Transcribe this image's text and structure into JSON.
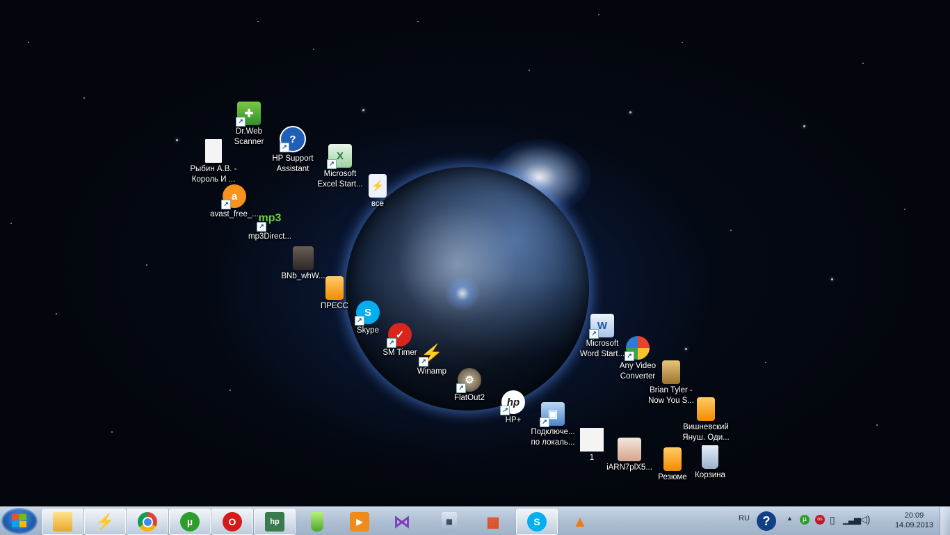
{
  "desktop": {
    "icons": [
      {
        "label": "Dr.Web\nScanner",
        "icon": "drweb-icon"
      },
      {
        "label": "HP Support\nAssistant",
        "icon": "help-icon"
      },
      {
        "label": "Рыбин А.В. -\nКороль И ...",
        "icon": "document-icon"
      },
      {
        "label": "Microsoft\nExcel Start...",
        "icon": "excel-icon"
      },
      {
        "label": "все",
        "icon": "winamp-playlist-icon"
      },
      {
        "label": "avast_free_...",
        "icon": "avast-icon"
      },
      {
        "label": "mp3Direct...",
        "icon": "mp3-icon"
      },
      {
        "label": "BNb_whW...",
        "icon": "image-icon"
      },
      {
        "label": "ПРЕСС",
        "icon": "folder-icon"
      },
      {
        "label": "Skype",
        "icon": "skype-icon"
      },
      {
        "label": "SM Timer",
        "icon": "timer-icon"
      },
      {
        "label": "Winamp",
        "icon": "winamp-icon"
      },
      {
        "label": "FlatOut2",
        "icon": "flatout-icon"
      },
      {
        "label": "HP+",
        "icon": "hp-icon"
      },
      {
        "label": "Подключе...\nпо локаль...",
        "icon": "network-icon"
      },
      {
        "label": "1",
        "icon": "image-icon"
      },
      {
        "label": "iARN7plX5...",
        "icon": "image-icon"
      },
      {
        "label": "Резюме",
        "icon": "folder-icon"
      },
      {
        "label": "Корзина",
        "icon": "recycle-bin-icon"
      },
      {
        "label": "Microsoft\nWord Start...",
        "icon": "word-icon"
      },
      {
        "label": "Any Video\nConverter",
        "icon": "converter-icon"
      },
      {
        "label": "Brian Tyler -\nNow You S...",
        "icon": "folder-icon"
      },
      {
        "label": "Вишневский\nЯнуш. Оди...",
        "icon": "folder-icon"
      }
    ]
  },
  "taskbar": {
    "start": "start-orb-icon",
    "pinned": [
      {
        "name": "explorer",
        "icon": "folder-icon"
      },
      {
        "name": "winamp",
        "icon": "winamp-icon"
      },
      {
        "name": "chrome",
        "icon": "chrome-icon"
      },
      {
        "name": "utorrent",
        "icon": "utorrent-icon"
      },
      {
        "name": "opera",
        "icon": "opera-icon"
      },
      {
        "name": "hp",
        "icon": "hp-icon"
      },
      {
        "name": "drink",
        "icon": "glass-icon"
      },
      {
        "name": "media-player",
        "icon": "play-icon"
      },
      {
        "name": "visual-studio",
        "icon": "bowtie-icon"
      },
      {
        "name": "calculator",
        "icon": "calculator-icon"
      },
      {
        "name": "apps",
        "icon": "grid-icon"
      },
      {
        "name": "skype",
        "icon": "skype-icon"
      },
      {
        "name": "vlc",
        "icon": "cone-icon"
      }
    ],
    "tray": {
      "language": "RU",
      "time": "20:09",
      "date": "14.09.2013"
    }
  },
  "colors": {
    "taskbar": "#aebfd3",
    "desktop": "#03060c"
  }
}
